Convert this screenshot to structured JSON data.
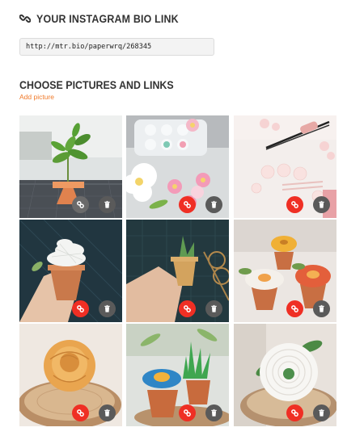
{
  "header": {
    "title": "YOUR INSTAGRAM BIO LINK",
    "icon": "link-icon"
  },
  "bio_link": {
    "value": "http://mtr.bio/paperwrq/268345"
  },
  "section": {
    "title": "CHOOSE PICTURES AND LINKS",
    "add_label": "Add picture"
  },
  "colors": {
    "accent": "#f07a2a",
    "link_button": "#ef2f24",
    "delete_button": "#5a5a5a"
  },
  "pictures": [
    {
      "subject": "paper plant in terracotta pot",
      "link_icon": "link-icon",
      "delete_icon": "trash-icon"
    },
    {
      "subject": "paper flowers in paint palette",
      "link_icon": "link-icon",
      "delete_icon": "trash-icon"
    },
    {
      "subject": "tweezers with paper petals",
      "link_icon": "link-icon",
      "delete_icon": "trash-icon"
    },
    {
      "subject": "hand holding white paper succulent",
      "link_icon": "link-icon",
      "delete_icon": "trash-icon"
    },
    {
      "subject": "hand holding paper cactus",
      "link_icon": "link-icon",
      "delete_icon": "trash-icon"
    },
    {
      "subject": "orange and white paper flowers in pots",
      "link_icon": "link-icon",
      "delete_icon": "trash-icon"
    },
    {
      "subject": "orange paper rose on wood slice",
      "link_icon": "link-icon",
      "delete_icon": "trash-icon"
    },
    {
      "subject": "blue flower and cactus in pots",
      "link_icon": "link-icon",
      "delete_icon": "trash-icon"
    },
    {
      "subject": "white paper peony on wood slice",
      "link_icon": "link-icon",
      "delete_icon": "trash-icon"
    }
  ]
}
